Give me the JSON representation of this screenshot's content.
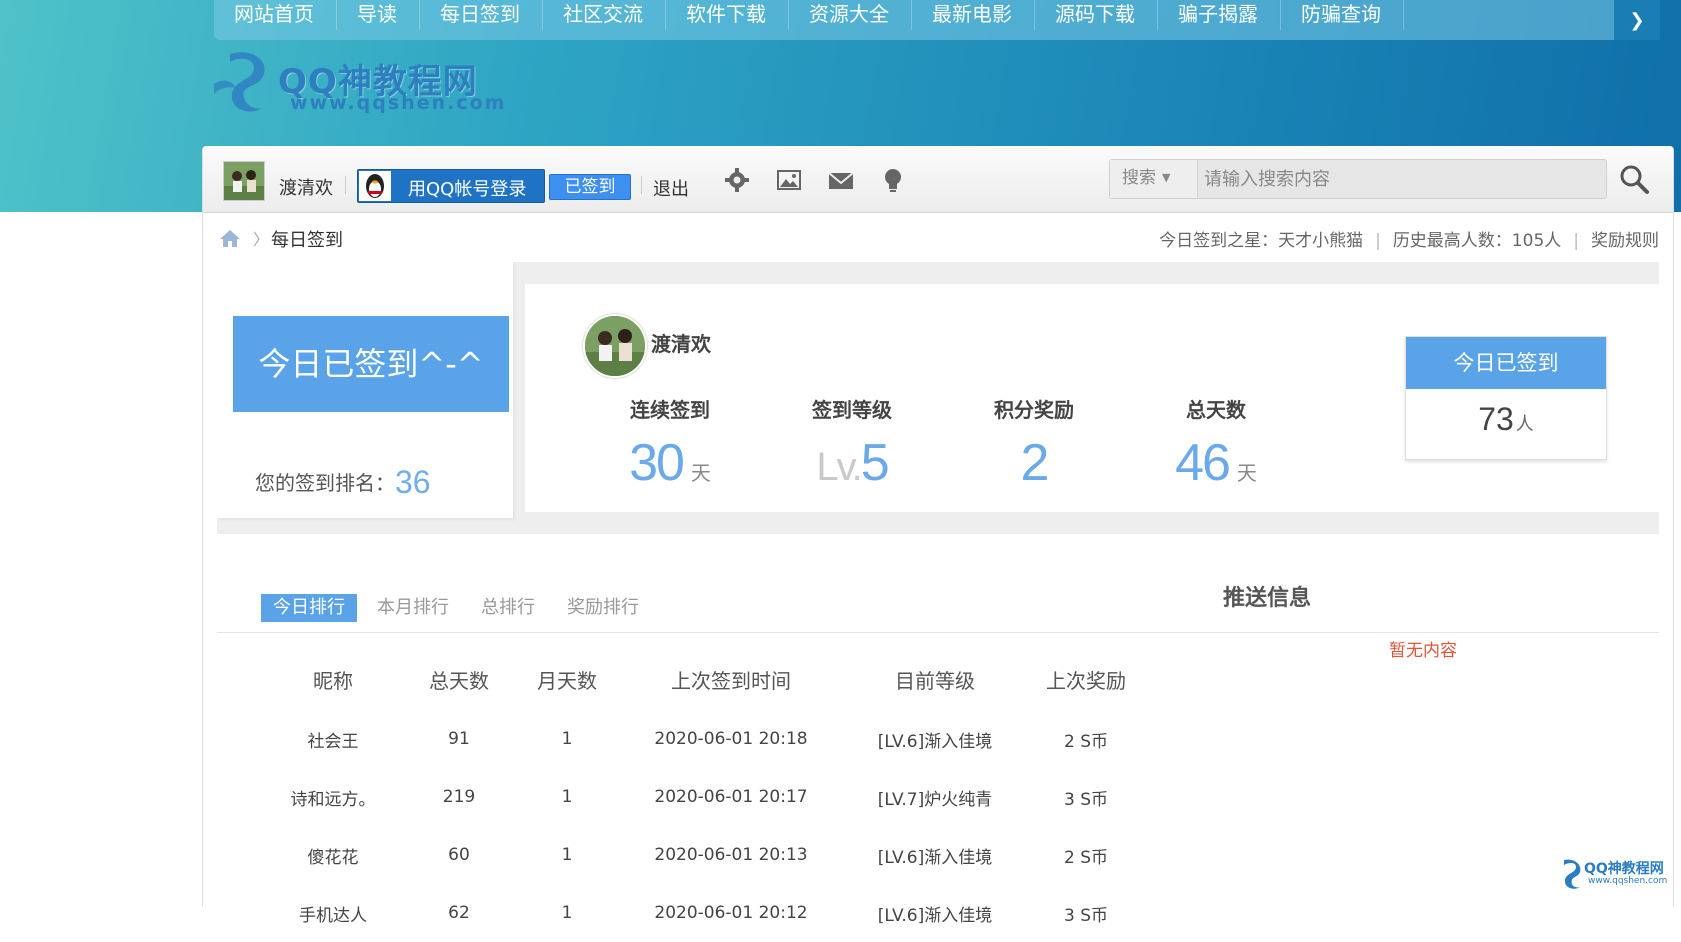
{
  "nav": {
    "items": [
      "网站首页",
      "导读",
      "每日签到",
      "社区交流",
      "软件下载",
      "资源大全",
      "最新电影",
      "源码下载",
      "骗子揭露",
      "防骗查询"
    ]
  },
  "logo": {
    "name": "QQ神教程网",
    "url": "www.qqshen.com"
  },
  "userbar": {
    "username": "渡清欢",
    "qq_login_label": "用QQ帐号登录",
    "signed_label": "已签到",
    "logout_label": "退出",
    "icons": [
      "gear-icon",
      "image-icon",
      "mail-icon",
      "bulb-icon"
    ],
    "search": {
      "type_label": "搜索",
      "placeholder": "请输入搜索内容"
    }
  },
  "breadcrumb": {
    "current": "每日签到",
    "star_label": "今日签到之星：天才小熊猫",
    "record_label": "历史最高人数：105人",
    "rules_label": "奖励规则"
  },
  "sign_panel": {
    "status_big": "今日已签到^-^",
    "rank_label": "您的签到排名：",
    "rank_value": "36",
    "username": "渡清欢",
    "stats": [
      {
        "label": "连续签到",
        "value": "30",
        "unit": "天"
      },
      {
        "label": "签到等级",
        "prefix": "Lv.",
        "value": "5",
        "unit": ""
      },
      {
        "label": "积分奖励",
        "value": "2",
        "unit": ""
      },
      {
        "label": "总天数",
        "value": "46",
        "unit": "天"
      }
    ],
    "today_box": {
      "title": "今日已签到",
      "count": "73",
      "unit": "人"
    }
  },
  "ranking": {
    "tabs": [
      "今日排行",
      "本月排行",
      "总排行",
      "奖励排行"
    ],
    "active_tab": 0,
    "columns": [
      "昵称",
      "总天数",
      "月天数",
      "上次签到时间",
      "目前等级",
      "上次奖励"
    ],
    "rows": [
      [
        "社会王",
        "91",
        "1",
        "2020-06-01 20:18",
        "[LV.6]渐入佳境",
        "2 S币"
      ],
      [
        "诗和远方。",
        "219",
        "1",
        "2020-06-01 20:17",
        "[LV.7]炉火纯青",
        "3 S币"
      ],
      [
        "傻花花",
        "60",
        "1",
        "2020-06-01 20:13",
        "[LV.6]渐入佳境",
        "2 S币"
      ],
      [
        "手机达人",
        "62",
        "1",
        "2020-06-01 20:12",
        "[LV.6]渐入佳境",
        "3 S币"
      ]
    ]
  },
  "push": {
    "title": "推送信息",
    "empty": "暂无内容"
  },
  "corner_logo": {
    "name": "QQ神教程网",
    "url": "www.qqshen.com"
  },
  "colors": {
    "accent": "#5aa3e8",
    "nav_bg": "#1a7db3",
    "empty_text": "#e2553a"
  }
}
